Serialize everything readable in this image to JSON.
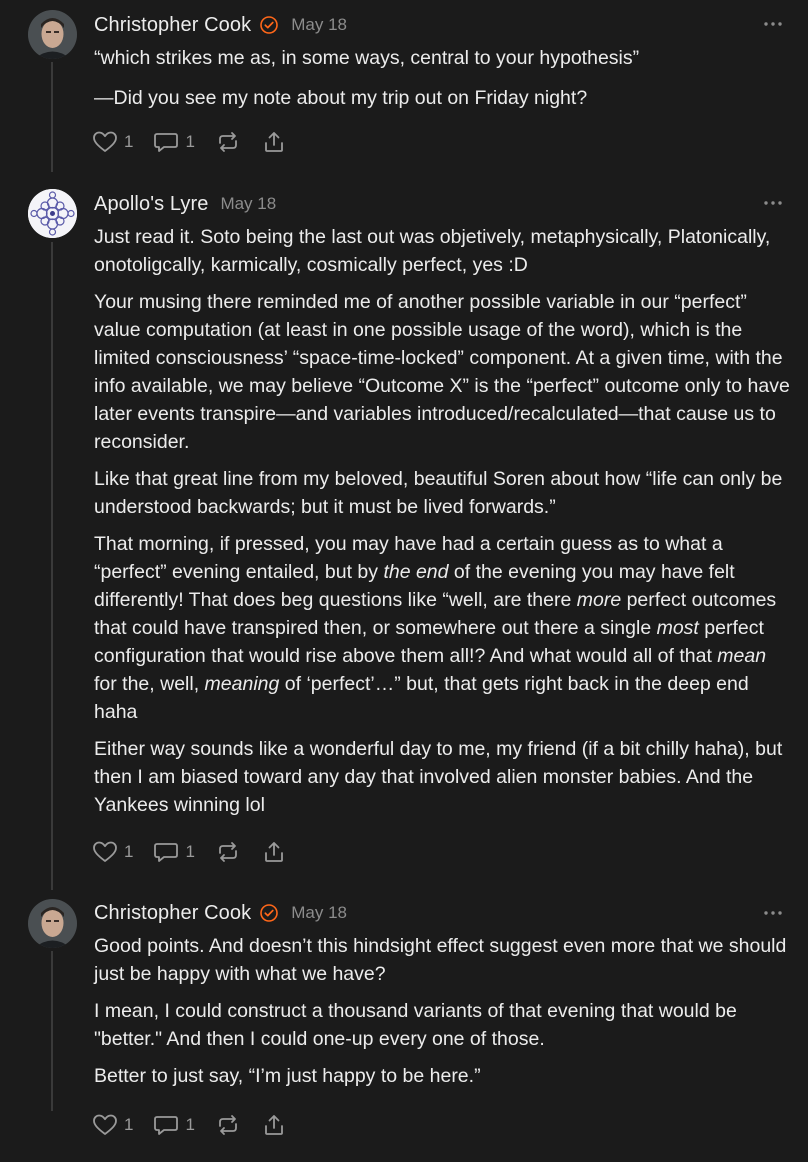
{
  "comments": [
    {
      "author": "Christopher Cook",
      "date": "May 18",
      "verified": true,
      "paragraphs": [
        "“which strikes me as, in some ways, central to your hypothesis”",
        "—Did you see my note about my trip out on Friday night?"
      ],
      "likes": "1",
      "replies": "1"
    },
    {
      "author": "Apollo's Lyre",
      "date": "May 18",
      "verified": false,
      "p1": "Just read it. Soto being the last out was objetively, metaphysically, Platonically, onotoligcally, karmically, cosmically perfect, yes :D",
      "p2": "Your musing there reminded me of another possible variable in our “perfect” value computation (at least in one possible usage of the word), which is the limited consciousness’ “space-time-locked” component. At a given time, with the info available, we may believe “Outcome X” is the “perfect” outcome only to have later events transpire—and variables introduced/recalculated—that cause us to reconsider.",
      "p3": "Like that great line from my beloved, beautiful Soren about how “life can only be understood backwards; but it must be lived forwards.”",
      "p4": {
        "a": "That morning, if pressed, you may have had a certain guess as to what a “perfect” evening entailed, but by ",
        "b": "the end",
        "c": " of the evening you may have felt differently! That does beg questions like “well, are there ",
        "d": "more",
        "e": " perfect outcomes that could have transpired then, or somewhere out there a single ",
        "f": "most",
        "g": " perfect configuration that would rise above them all!? And what would all of that ",
        "h": "mean",
        "i": " for the, well, ",
        "j": "meaning",
        "k": " of ‘perfect’…” but, that gets right back in the deep end haha"
      },
      "p5": "Either way sounds like a wonderful day to me, my friend (if a bit chilly haha), but then I am biased toward any day that involved alien monster babies. And the Yankees winning lol",
      "likes": "1",
      "replies": "1"
    },
    {
      "author": "Christopher Cook",
      "date": "May 18",
      "verified": true,
      "paragraphs": [
        "Good points. And doesn’t this hindsight effect suggest even more that we should just be happy with what we have?",
        "I mean, I could construct a thousand variants of that evening that would be \"better.\" And then I could one-up every one of those.",
        "Better to just say, “I’m just happy to be here.”"
      ],
      "likes": "1",
      "replies": "1"
    }
  ],
  "icons": {
    "verified": "verified-badge-icon",
    "more": "more-options-icon",
    "like": "heart-icon",
    "reply": "speech-bubble-icon",
    "restack": "restack-icon",
    "share": "share-icon"
  },
  "colors": {
    "background": "#1b1b1b",
    "text": "#ececec",
    "muted": "#8c8c8c",
    "accent": "#ff6719"
  }
}
